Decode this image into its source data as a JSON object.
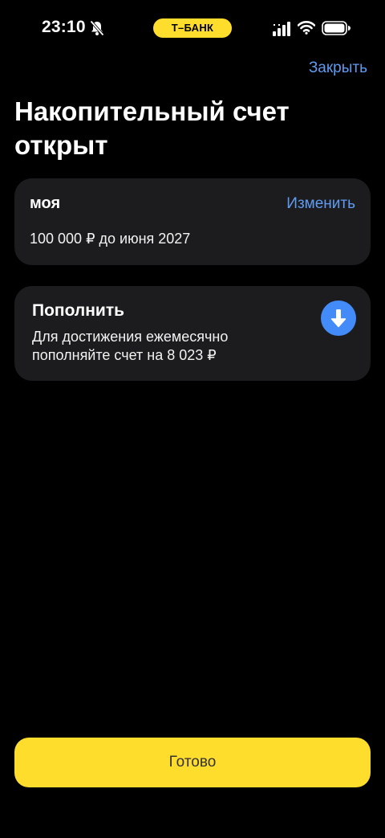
{
  "status_bar": {
    "time": "23:10",
    "brand": "Т–БАНК",
    "icons": [
      "bell-muted-icon",
      "cellular-signal-icon",
      "wifi-icon",
      "battery-icon"
    ]
  },
  "header": {
    "close_label": "Закрыть",
    "title": "Накопительный счет открыт"
  },
  "goal_card": {
    "name": "моя",
    "edit_label": "Изменить",
    "amount_text": "100 000 ₽ до июня 2027"
  },
  "topup_card": {
    "title": "Пополнить",
    "description": "Для достижения ежемесячно пополняйте счет на 8 023 ₽",
    "icon": "arrow-down-icon"
  },
  "footer": {
    "done_label": "Готово"
  },
  "colors": {
    "background": "#000000",
    "card": "#1c1c1e",
    "accent_blue": "#5f9bf0",
    "icon_button_blue": "#428bf9",
    "brand_yellow": "#ffdd2d"
  }
}
